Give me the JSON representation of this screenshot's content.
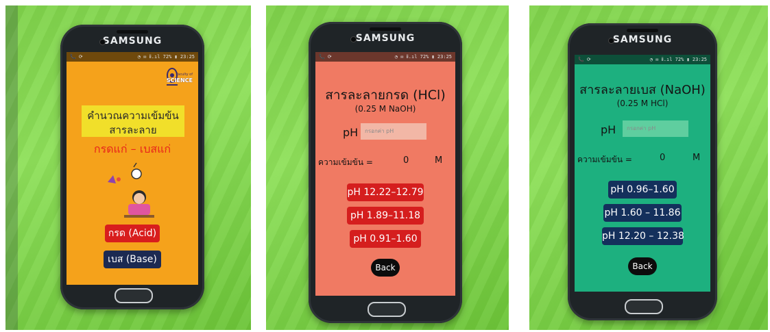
{
  "phones": [
    {
      "brand": "SAMSUNG",
      "status_left": "📞 ⟳",
      "status_right": "◔ ✉ ⅱ.ıl 72% ▮ 23:25",
      "logo_text_top": "Faculty of",
      "logo_text": "SCIENCE",
      "title_line1": "คำนวณความเข้มข้น",
      "title_line2": "สารละลาย",
      "subtitle": "กรดแก่ – เบสแก่",
      "acid_button": "กรด (Acid)",
      "base_button": "เบส (Base)",
      "colors": {
        "screen": "#f5a21b",
        "banner": "#f1df2a",
        "subtitle": "#e8251b",
        "acid": "#d81d1d",
        "base": "#1c2a52"
      }
    },
    {
      "brand": "SAMSUNG",
      "status_left": "📞 ⟳",
      "status_right": "◔ ✉ ⅱ.ıl 72% ▮ 23:25",
      "title": "สารละลายกรด (HCl)",
      "subtitle": "(0.25 M NaOH)",
      "ph_label": "pH",
      "ph_placeholder": "กรอกค่า pH",
      "conc_label": "ความเข้มข้น =",
      "conc_value": "0",
      "conc_unit": "M",
      "ranges": [
        "pH 12.22–12.79",
        "pH 1.89–11.18",
        "pH 0.91–1.60"
      ],
      "back_label": "Back",
      "colors": {
        "screen": "#f07a63",
        "button": "#d51e1e",
        "input": "#f2b7a6"
      }
    },
    {
      "brand": "SAMSUNG",
      "status_left": "📞 ⟳",
      "status_right": "◔ ✉ ⅱ.ıl 72% ▮ 23:25",
      "title": "สารละลายเบส (NaOH)",
      "subtitle": "(0.25 M HCl)",
      "ph_label": "pH",
      "ph_placeholder": "กรอกค่า pH",
      "conc_label": "ความเข้มข้น =",
      "conc_value": "0",
      "conc_unit": "M",
      "ranges": [
        "pH 0.96–1.60",
        "pH 1.60 – 11.86",
        "pH 12.20 – 12.38"
      ],
      "back_label": "Back",
      "colors": {
        "screen": "#1db07f",
        "button": "#14305c",
        "input": "#5fce9f"
      }
    }
  ]
}
